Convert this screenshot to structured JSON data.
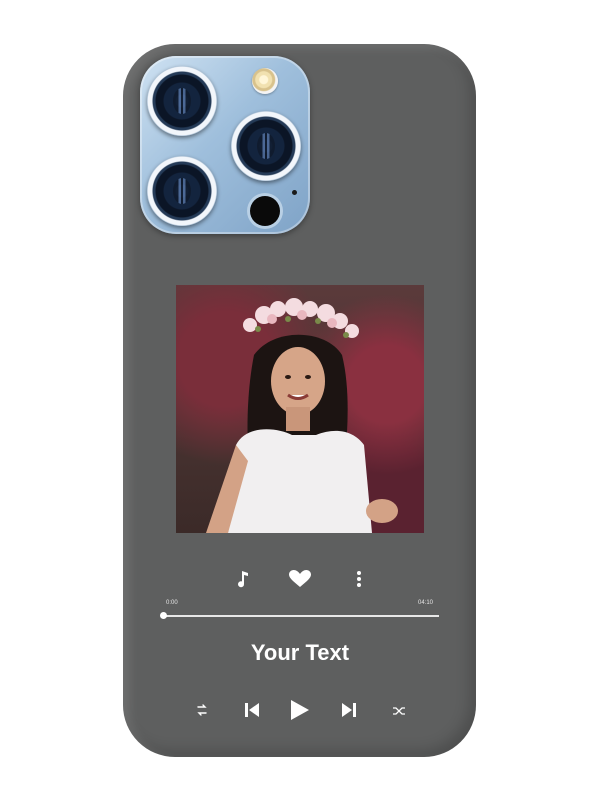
{
  "product": {
    "case_color": "#5e5f5f",
    "camera_color": "#9fbfdc"
  },
  "photo": {
    "subject": "portrait-photo"
  },
  "player": {
    "current_time": "0:00",
    "total_time": "04:10",
    "progress": 0.0,
    "caption": "Your Text",
    "top_icons": [
      "music-note-icon",
      "heart-icon",
      "more-vertical-icon"
    ],
    "bottom_icons": [
      "repeat-icon",
      "previous-icon",
      "play-icon",
      "next-icon",
      "shuffle-icon"
    ]
  }
}
